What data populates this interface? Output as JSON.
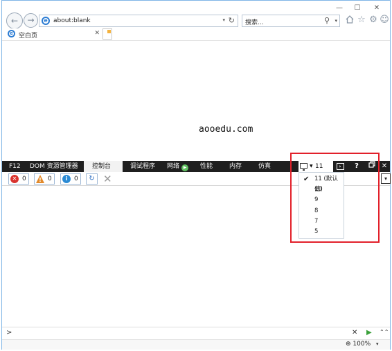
{
  "window": {
    "controls": [
      "—",
      "☐",
      "✕"
    ]
  },
  "navbar": {
    "back": "←",
    "forward": "→",
    "address": "about:blank",
    "address_dropdown": "▾",
    "refresh": "↻",
    "search_placeholder": "搜索...",
    "search_icon": "⚲",
    "search_dropdown": "▾",
    "icons": [
      "home-icon",
      "favorites-star-icon",
      "settings-gear-icon",
      "feedback-smiley-icon"
    ]
  },
  "tab": {
    "title": "空白页",
    "close": "✕"
  },
  "page": {
    "watermark": "aooedu.com"
  },
  "devtools": {
    "tabs": [
      {
        "label": "F12",
        "active": false
      },
      {
        "label": "DOM 资源管理器",
        "active": false
      },
      {
        "label": "控制台",
        "active": true
      },
      {
        "label": "调试程序",
        "active": false
      },
      {
        "label": "网络",
        "active": false
      },
      {
        "label": "性能",
        "active": false
      },
      {
        "label": "内存",
        "active": false
      },
      {
        "label": "仿真",
        "active": false
      }
    ],
    "emulation_value": "11",
    "right_buttons": {
      "help": "?",
      "close": "✕"
    },
    "counters": {
      "errors": "0",
      "warnings": "0",
      "info": "0"
    },
    "right_dropdown": "▾",
    "document_modes": [
      {
        "label": "11 (默认值)",
        "selected": true
      },
      {
        "label": "10",
        "selected": false
      },
      {
        "label": "9",
        "selected": false
      },
      {
        "label": "8",
        "selected": false
      },
      {
        "label": "7",
        "selected": false
      },
      {
        "label": "5",
        "selected": false
      }
    ],
    "cmdline": {
      "prompt": ">",
      "clear": "✕",
      "run": "▶",
      "expand": "⌃⌃"
    }
  },
  "status": {
    "zoom": "100%",
    "zoom_dropdown": "▾"
  },
  "colors": {
    "highlight_box": "#e2202a",
    "devtools_bar": "#1f1f1f",
    "ie_blue": "#2b7cd3"
  }
}
